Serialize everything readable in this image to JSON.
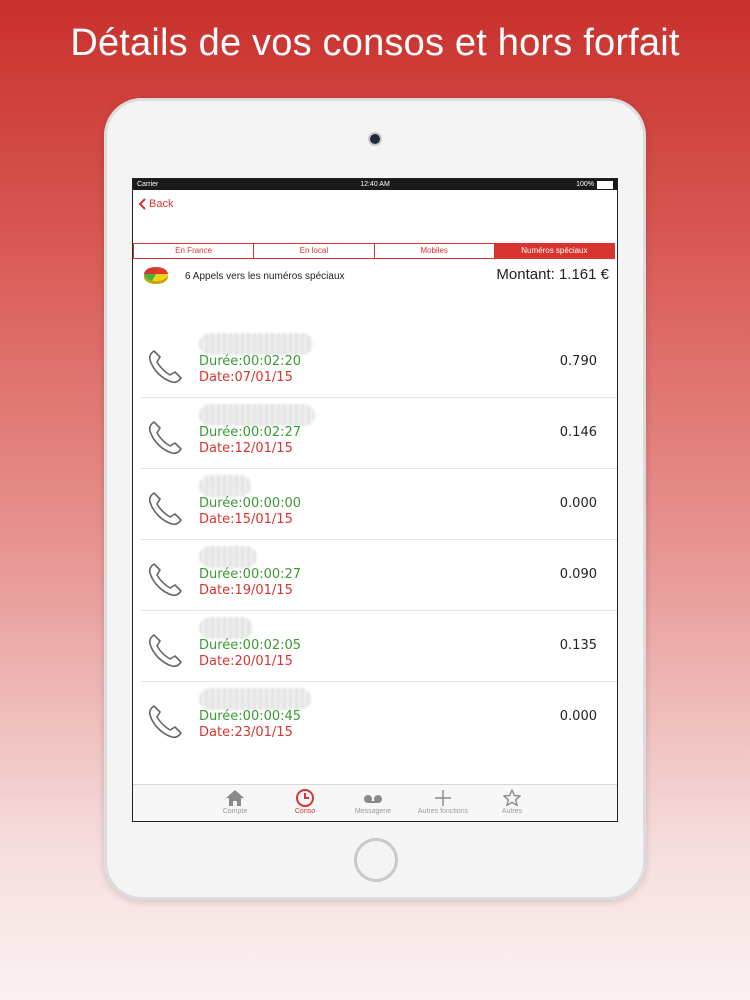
{
  "promo": {
    "title": "Détails de vos consos et hors forfait"
  },
  "status_bar": {
    "carrier": "Carrier",
    "time": "12:40 AM",
    "battery": "100%"
  },
  "nav": {
    "back_label": "Back"
  },
  "segments": [
    {
      "label": "En France",
      "active": false
    },
    {
      "label": "En local",
      "active": false
    },
    {
      "label": "Mobiles",
      "active": false
    },
    {
      "label": "Numéros spéciaux",
      "active": true
    }
  ],
  "summary": {
    "label": "6 Appels vers les numéros spéciaux",
    "amount": "Montant: 1.161 €"
  },
  "calls": [
    {
      "duration": "Durée:00:02:20",
      "date": "Date:07/01/15",
      "amount": "0.790"
    },
    {
      "duration": "Durée:00:02:27",
      "date": "Date:12/01/15",
      "amount": "0.146"
    },
    {
      "duration": "Durée:00:00:00",
      "date": "Date:15/01/15",
      "amount": "0.000"
    },
    {
      "duration": "Durée:00:00:27",
      "date": "Date:19/01/15",
      "amount": "0.090"
    },
    {
      "duration": "Durée:00:02:05",
      "date": "Date:20/01/15",
      "amount": "0.135"
    },
    {
      "duration": "Durée:00:00:45",
      "date": "Date:23/01/15",
      "amount": "0.000"
    }
  ],
  "tabs": [
    {
      "label": "Compte",
      "icon": "home-icon",
      "active": false
    },
    {
      "label": "Conso",
      "icon": "clock-icon",
      "active": true
    },
    {
      "label": "Messagerie",
      "icon": "voicemail-icon",
      "active": false
    },
    {
      "label": "Autres fonctions",
      "icon": "plus-icon",
      "active": false
    },
    {
      "label": "Autres",
      "icon": "star-icon",
      "active": false
    }
  ],
  "colors": {
    "accent": "#d8342f",
    "duration": "#3a9a33"
  }
}
